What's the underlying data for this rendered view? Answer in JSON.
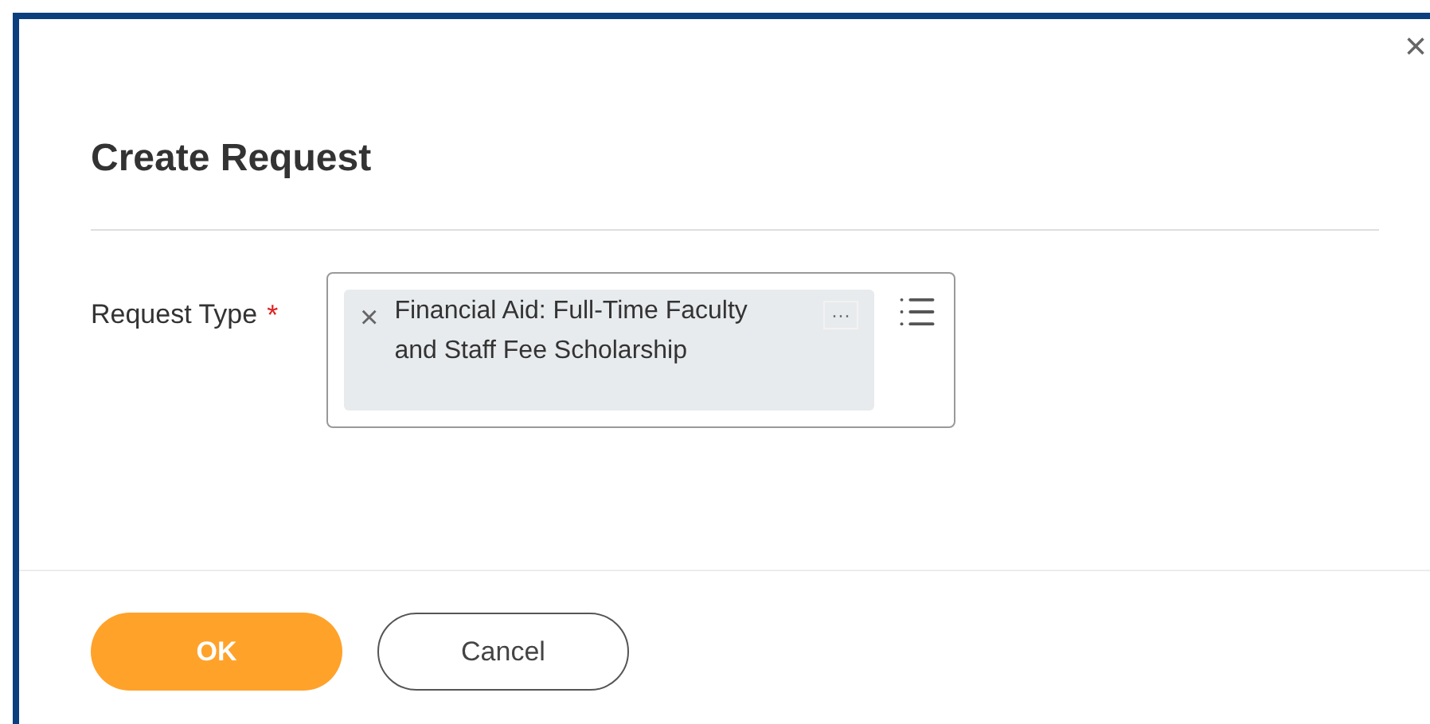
{
  "dialog": {
    "title": "Create Request",
    "field": {
      "label": "Request Type",
      "required": true,
      "required_mark": "*",
      "chip": {
        "remove": "×",
        "value": "Financial Aid: Full-Time Faculty and Staff Fee Scholarship",
        "more": "···"
      }
    },
    "buttons": [
      {
        "label": "OK",
        "kind": "primary"
      },
      {
        "label": "Cancel",
        "kind": "secondary"
      }
    ],
    "close": "×"
  }
}
